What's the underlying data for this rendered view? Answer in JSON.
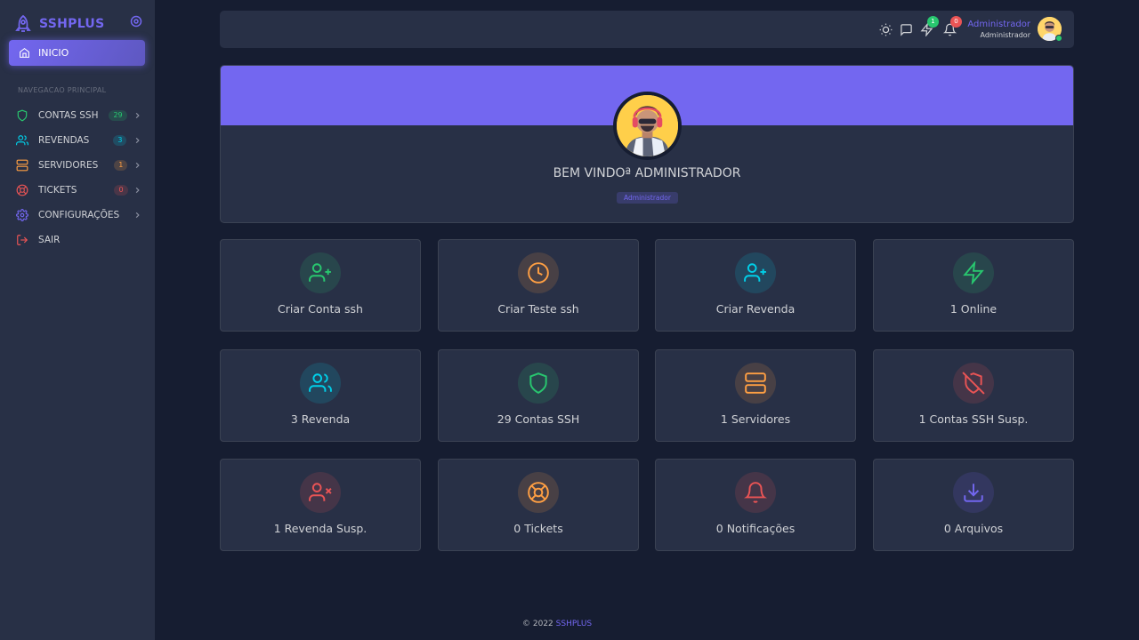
{
  "brand": {
    "name": "SSHPLUS"
  },
  "sidebar": {
    "active_item": "INICIO",
    "section_header": "NAVEGACAO PRINCIPAL",
    "items": [
      {
        "label": "CONTAS SSH",
        "badge": "29",
        "icon": "shield-icon",
        "color": "#28c76f"
      },
      {
        "label": "REVENDAS",
        "badge": "3",
        "icon": "users-icon",
        "color": "#00cfe8"
      },
      {
        "label": "SERVIDORES",
        "badge": "1",
        "icon": "server-icon",
        "color": "#ff9f43"
      },
      {
        "label": "TICKETS",
        "badge": "0",
        "icon": "life-buoy-icon",
        "color": "#ea5455"
      },
      {
        "label": "CONFIGURAÇÕES",
        "badge": "",
        "icon": "gear-icon",
        "color": "#7367f0"
      },
      {
        "label": "SAIR",
        "badge": "",
        "icon": "logout-icon",
        "color": "#ea5455"
      }
    ]
  },
  "navbar": {
    "bolt_count": "1",
    "bell_count": "0",
    "user_name": "Administrador",
    "user_role": "Administrador"
  },
  "welcome": {
    "title": "BEM VINDOª ADMINISTRADOR",
    "role_badge": "Administrador"
  },
  "cards": [
    {
      "label": "Criar Conta ssh",
      "icon": "user-plus-icon",
      "color": "#28c76f"
    },
    {
      "label": "Criar Teste ssh",
      "icon": "clock-icon",
      "color": "#ff9f43"
    },
    {
      "label": "Criar Revenda",
      "icon": "user-plus-icon",
      "color": "#00cfe8"
    },
    {
      "label": "1 Online",
      "icon": "zap-icon",
      "color": "#28c76f"
    },
    {
      "label": "3 Revenda",
      "icon": "users-icon",
      "color": "#00cfe8"
    },
    {
      "label": "29 Contas SSH",
      "icon": "shield-icon",
      "color": "#28c76f"
    },
    {
      "label": "1 Servidores",
      "icon": "server-icon",
      "color": "#ff9f43"
    },
    {
      "label": "1 Contas SSH Susp.",
      "icon": "shield-off-icon",
      "color": "#ea5455"
    },
    {
      "label": "1 Revenda Susp.",
      "icon": "user-x-icon",
      "color": "#ea5455"
    },
    {
      "label": "0 Tickets",
      "icon": "life-buoy-icon",
      "color": "#ff9f43"
    },
    {
      "label": "0 Notificações",
      "icon": "bell-icon",
      "color": "#ea5455"
    },
    {
      "label": "0 Arquivos",
      "icon": "download-icon",
      "color": "#7367f0"
    }
  ],
  "footer": {
    "copyright": "© 2022",
    "brand_link": "SSHPLUS"
  },
  "colors": {
    "primary": "#7367f0",
    "success": "#28c76f",
    "info": "#00cfe8",
    "warning": "#ff9f43",
    "danger": "#ea5455"
  }
}
